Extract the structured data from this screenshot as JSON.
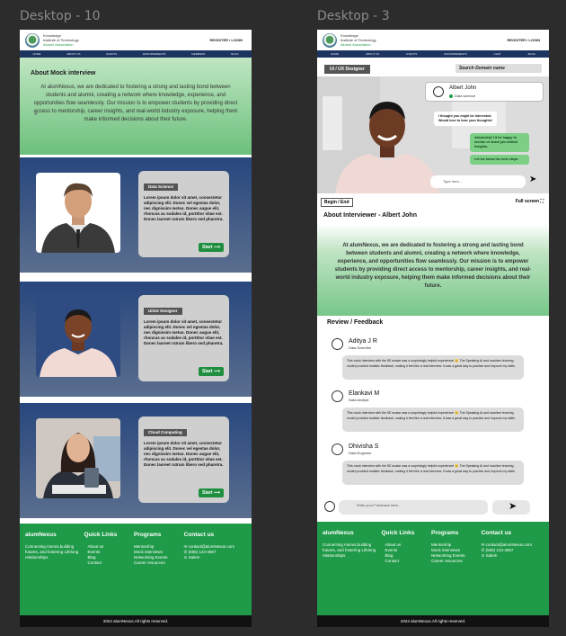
{
  "frames": {
    "left_label": "Desktop - 10",
    "right_label": "Desktop - 3"
  },
  "header": {
    "institute_line1": "Knowledge",
    "institute_line2": "Institute of Technology",
    "institute_line3": "Alumni Association",
    "register_login": "REGISTER / LOGIN",
    "nav": [
      "HOME",
      "ABOUT US",
      "EVENTS",
      "ENDORSEMENTS",
      "MEMBERS",
      "BLOG"
    ]
  },
  "header2": {
    "nav": [
      "HOME",
      "ABOUT US",
      "EVENTS",
      "ENDORSEMENTS",
      "CHAT",
      "BLOG"
    ]
  },
  "about_mock": {
    "title": "About Mock interview",
    "text": "At alumNexus, we are dedicated to fostering a strong and lasting bond between students and alumni, creating a network where knowledge, experience, and opportunities flow seamlessly. Our mission is to empower students by providing direct access to mentorship, career insights, and real-world industry exposure, helping them make informed decisions about their future."
  },
  "domains": [
    {
      "tag": "Data Science",
      "text": "Lorem ipsum dolor sit amet, consectetur adipiscing elit. Donec vel egestas dolor, nec dignissim metus. Donec augue elit, rhoncus ac sodales id, porttitor vitae est. Donec laoreet rutrum libero sed pharetra.",
      "button": "Start"
    },
    {
      "tag": "Ui/UX Designer",
      "text": "Lorem ipsum dolor sit amet, consectetur adipiscing elit. Donec vel egestas dolor, nec dignissim metus. Donec augue elit, rhoncus ac sodales id, porttitor vitae est. Donec laoreet rutrum libero sed pharetra.",
      "button": "Start"
    },
    {
      "tag": "Cloud Computing",
      "text": "Lorem ipsum dolor sit amet, consectetur adipiscing elit. Donec vel egestas dolor, nec dignissim metus. Donec augue elit, rhoncus ac sodales id, porttitor vitae est. Donec laoreet rutrum libero sed pharetra.",
      "button": "Start"
    }
  ],
  "footer": {
    "brand": "alumNexus",
    "brand_text": "Connecting Alumni,building futures, and fostering Lifelong relationships.",
    "quick_title": "Quick Links",
    "quick_links": [
      "About us",
      "Events",
      "Blog",
      "Contact"
    ],
    "programs_title": "Programs",
    "programs": [
      "Mentorship",
      "Mock interviews",
      "Networking Events",
      "Career resources"
    ],
    "contact_title": "Contact us",
    "email": "contact@alumNexus.com",
    "phone": "(555) 123-4567",
    "city": "Salem",
    "copyright": "2024 alumNexus.All rights reserved."
  },
  "interview": {
    "role_tag": "UI / UX Designer",
    "search_placeholder": "Search Domain name",
    "begin_end": "Begin / End",
    "fullscreen": "Full screen",
    "chat_user_name": "Albert John",
    "chat_user_status": "Data science",
    "msg_ai": "I thought you might be interested. Would love to hear your thoughts!",
    "msg_me1": "Absolutely! I'd be happy to mentor or share job-related insights.",
    "msg_me2": "Let me know the next steps.",
    "type_placeholder": "Type here..."
  },
  "about_interviewer": {
    "title": "About Interviewer - Albert John",
    "text": "At alumNexus, we are dedicated to fostering a strong and lasting bond between students and alumni, creating a network where knowledge, experience, and opportunities flow seamlessly. Our mission is to empower students by providing direct access to mentorship, career insights, and real-world industry exposure, helping them make informed decisions about their future."
  },
  "reviews": {
    "title": "Review / Feedback",
    "items": [
      {
        "name": "Aditya J R",
        "role": "Data Scientist",
        "text": "This mock interview with the SE avatar was a surprisingly helpful experience! 😊 The Speaking AI and machine learning model provided realistic feedback, making it feel like a real interview. It was a great way to practice and improve my skills."
      },
      {
        "name": "Elankavi M",
        "role": "Data Analyst",
        "text": "This mock interview with the SE avatar was a surprisingly helpful experience! 😊 The Speaking AI and machine learning model provided realistic feedback, making it feel like a real interview. It was a great way to practice and improve my skills."
      },
      {
        "name": "Dhivisha S",
        "role": "Data Engineer",
        "text": "This mock interview with the SE avatar was a surprisingly helpful experience! 😊 The Speaking AI and machine learning model provided realistic feedback, making it feel like a real interview. It was a great way to practice and improve my skills."
      }
    ],
    "feedback_placeholder": "Write your Feedback here..."
  }
}
